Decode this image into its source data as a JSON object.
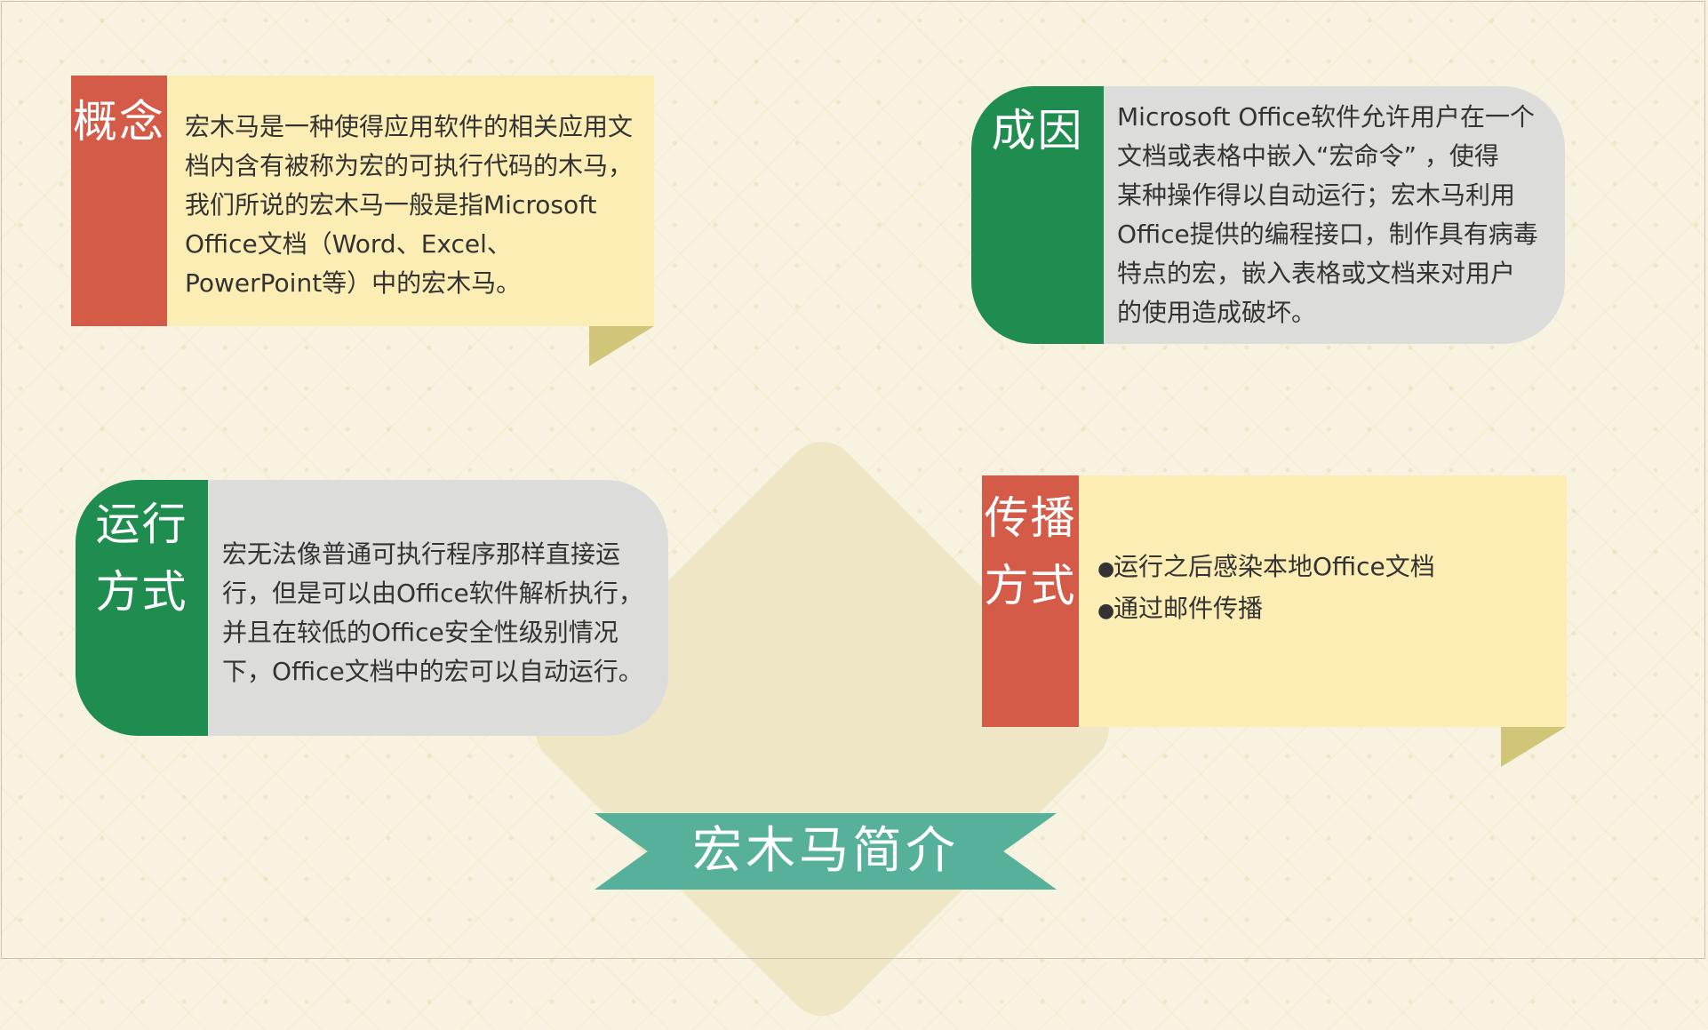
{
  "cards": {
    "concept": {
      "tag": "概念",
      "lines": [
        "宏木马是一种使得应用软件的相关应用文",
        "档内含有被称为宏的可执行代码的木马，",
        "我们所说的宏木马一般是指Microsoft",
        "Office文档（Word、Excel、",
        "PowerPoint等）中的宏木马。"
      ]
    },
    "cause": {
      "tag": "成因",
      "lines": [
        "Microsoft Office软件允许用户在一个",
        "文档或表格中嵌入“宏命令” ，使得",
        "某种操作得以自动运行；宏木马利用",
        "Office提供的编程接口，制作具有病毒",
        "特点的宏，嵌入表格或文档来对用户",
        "的使用造成破坏。"
      ]
    },
    "operation": {
      "tag_line1": "运行",
      "tag_line2": "方式",
      "lines": [
        "宏无法像普通可执行程序那样直接运",
        "行，但是可以由Office软件解析执行，",
        "并且在较低的Office安全性级别情况",
        "下，Office文档中的宏可以自动运行。"
      ]
    },
    "spread": {
      "tag_line1": "传播",
      "tag_line2": "方式",
      "bullets": [
        "运行之后感染本地Office文档",
        "通过邮件传播"
      ]
    }
  },
  "title": "宏木马简介",
  "colors": {
    "background": "#f8f3e0",
    "red": "#d45b48",
    "green": "#1f8d4f",
    "yellow_panel": "#fcedb4",
    "gray_panel": "#dcdddb",
    "teal_ribbon": "#56b09a",
    "fold": "#d1c579"
  }
}
